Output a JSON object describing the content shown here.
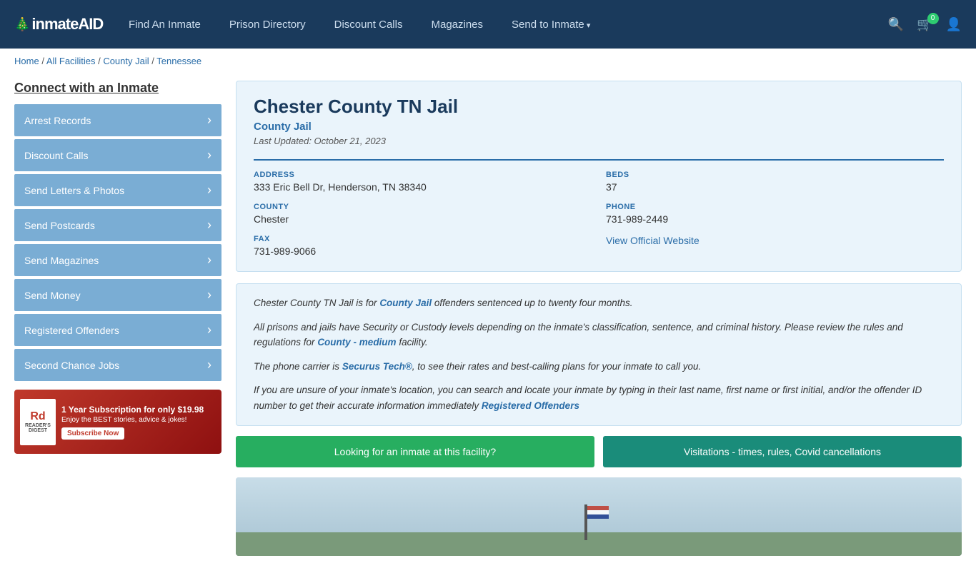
{
  "header": {
    "logo": "inmateAID",
    "cart_badge": "0",
    "nav": [
      {
        "id": "find-inmate",
        "label": "Find An Inmate",
        "arrow": false
      },
      {
        "id": "prison-directory",
        "label": "Prison Directory",
        "arrow": false
      },
      {
        "id": "discount-calls",
        "label": "Discount Calls",
        "arrow": false
      },
      {
        "id": "magazines",
        "label": "Magazines",
        "arrow": false
      },
      {
        "id": "send-to-inmate",
        "label": "Send to Inmate",
        "arrow": true
      }
    ]
  },
  "breadcrumb": {
    "home": "Home",
    "sep1": " / ",
    "all_facilities": "All Facilities",
    "sep2": " / ",
    "county_jail": "County Jail",
    "sep3": " / ",
    "state": "Tennessee"
  },
  "sidebar": {
    "title": "Connect with an Inmate",
    "items": [
      {
        "id": "arrest-records",
        "label": "Arrest Records"
      },
      {
        "id": "discount-calls",
        "label": "Discount Calls"
      },
      {
        "id": "send-letters-photos",
        "label": "Send Letters & Photos"
      },
      {
        "id": "send-postcards",
        "label": "Send Postcards"
      },
      {
        "id": "send-magazines",
        "label": "Send Magazines"
      },
      {
        "id": "send-money",
        "label": "Send Money"
      },
      {
        "id": "registered-offenders",
        "label": "Registered Offenders"
      },
      {
        "id": "second-chance-jobs",
        "label": "Second Chance Jobs"
      }
    ]
  },
  "ad": {
    "logo_text": "Rd",
    "logo_sub": "READER'S DIGEST",
    "title": "1 Year Subscription for only $19.98",
    "sub": "Enjoy the BEST stories, advice & jokes!",
    "btn": "Subscribe Now"
  },
  "facility": {
    "title": "Chester County TN Jail",
    "type": "County Jail",
    "updated": "Last Updated: October 21, 2023",
    "address_label": "ADDRESS",
    "address_value": "333 Eric Bell Dr, Henderson, TN 38340",
    "beds_label": "BEDS",
    "beds_value": "37",
    "county_label": "COUNTY",
    "county_value": "Chester",
    "phone_label": "PHONE",
    "phone_value": "731-989-2449",
    "fax_label": "FAX",
    "fax_value": "731-989-9066",
    "website_label": "View Official Website",
    "description1": "Chester County TN Jail is for County Jail offenders sentenced up to twenty four months.",
    "description2": "All prisons and jails have Security or Custody levels depending on the inmate's classification, sentence, and criminal history. Please review the rules and regulations for County - medium facility.",
    "description3": "The phone carrier is Securus Tech®, to see their rates and best-calling plans for your inmate to call you.",
    "description4": "If you are unsure of your inmate's location, you can search and locate your inmate by typing in their last name, first name or first initial, and/or the offender ID number to get their accurate information immediately Registered Offenders",
    "btn_inmate": "Looking for an inmate at this facility?",
    "btn_visitation": "Visitations - times, rules, Covid cancellations"
  }
}
